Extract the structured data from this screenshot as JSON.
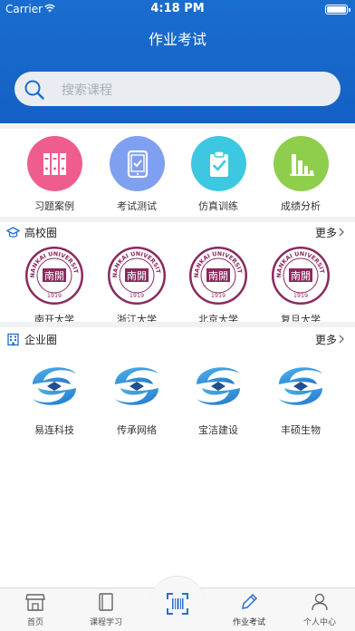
{
  "status": {
    "carrier": "Carrier",
    "time": "4:18 PM"
  },
  "nav": {
    "title": "作业考试"
  },
  "search": {
    "placeholder": "搜索课程"
  },
  "quick_actions": [
    {
      "label": "习题案例",
      "icon": "books-icon",
      "color": "#ef5d8f"
    },
    {
      "label": "考试测试",
      "icon": "tablet-icon",
      "color": "#7f9ff0"
    },
    {
      "label": "仿真训练",
      "icon": "clipboard-check-icon",
      "color": "#3ec7e0"
    },
    {
      "label": "成绩分析",
      "icon": "bar-chart-icon",
      "color": "#8fce4c"
    }
  ],
  "universities": {
    "title": "高校圈",
    "more": "更多",
    "items": [
      {
        "label": "南开大学"
      },
      {
        "label": "浙江大学"
      },
      {
        "label": "北京大学"
      },
      {
        "label": "复旦大学"
      }
    ],
    "logo_text": "NANKAI UNIVERSITY",
    "logo_year": "1919",
    "logo_glyph": "南開"
  },
  "companies": {
    "title": "企业圈",
    "more": "更多",
    "items": [
      {
        "label": "易连科技"
      },
      {
        "label": "传承网络"
      },
      {
        "label": "宝洁建设"
      },
      {
        "label": "丰硕生物"
      }
    ]
  },
  "tabs": [
    {
      "label": "首页",
      "icon": "store-icon"
    },
    {
      "label": "课程学习",
      "icon": "book-icon"
    },
    {
      "label": "",
      "icon": "scan-barcode-icon"
    },
    {
      "label": "作业考试",
      "icon": "pencil-icon"
    },
    {
      "label": "个人中心",
      "icon": "person-icon"
    }
  ],
  "colors": {
    "primary": "#1a6dd0",
    "university": "#8a2a5e",
    "corp_blue": "#2a8fd8"
  }
}
